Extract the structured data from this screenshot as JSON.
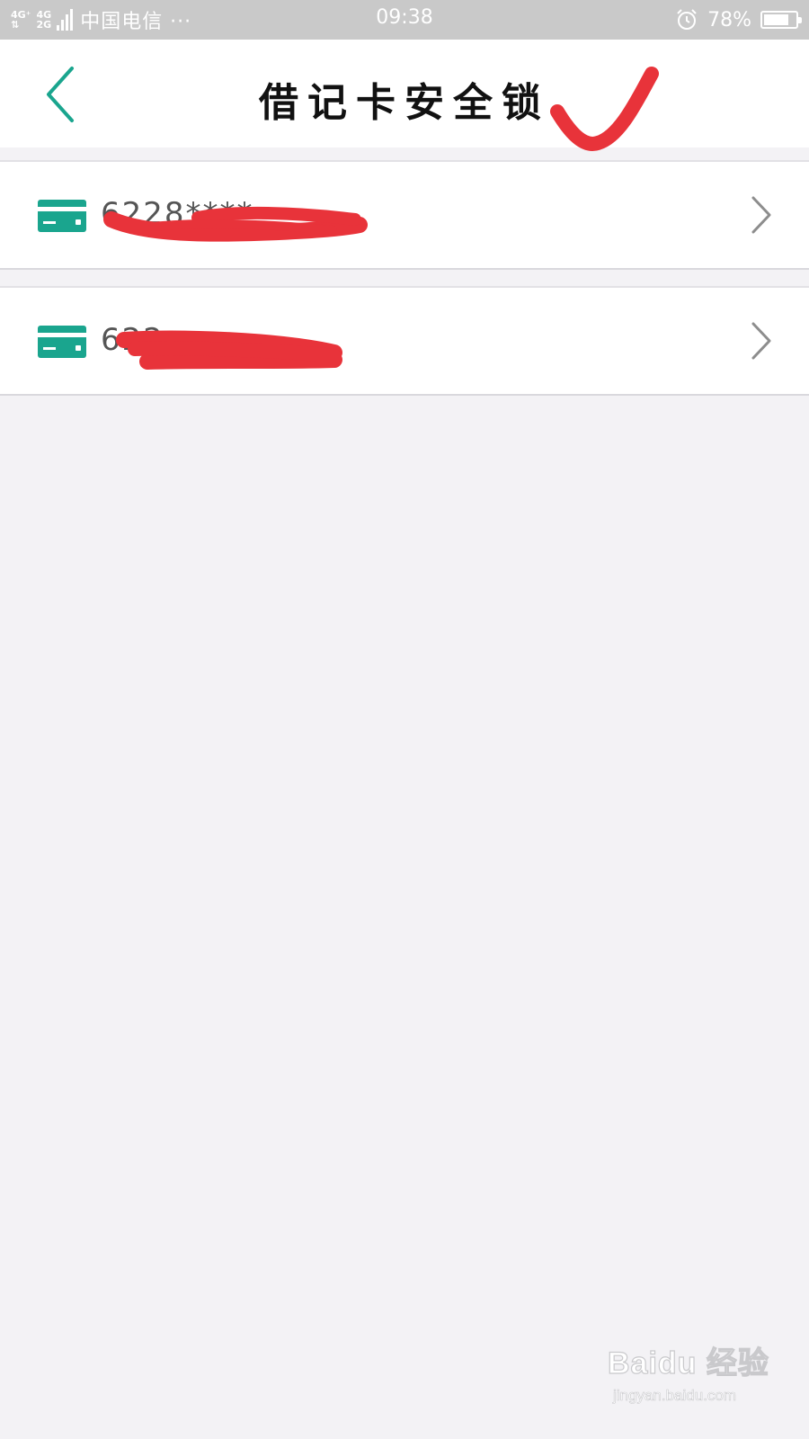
{
  "status_bar": {
    "network_1": "4G⁺",
    "network_2_top": "4G",
    "network_2_bottom": "2G",
    "carrier": "中国电信 ···",
    "time": "09:38",
    "alarm_icon": "alarm-clock-icon",
    "battery_percent": "78%",
    "battery_level": 0.78
  },
  "nav": {
    "back_icon": "chevron-left-icon",
    "title": "借记卡安全锁"
  },
  "cards": [
    {
      "number": "6228****",
      "icon": "credit-card-icon",
      "chevron": "chevron-right-icon"
    },
    {
      "number": "622",
      "icon": "credit-card-icon",
      "chevron": "chevron-right-icon"
    }
  ],
  "watermark": {
    "brand": "Baidu 经验",
    "url": "jingyan.baidu.com"
  },
  "colors": {
    "accent_teal": "#1aa58e",
    "annotation_red": "#e8333a",
    "status_bar": "#c9c9c9",
    "background": "#f3f2f5"
  }
}
